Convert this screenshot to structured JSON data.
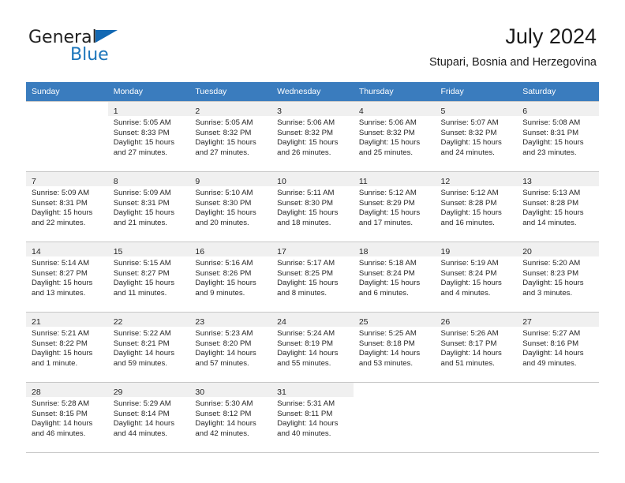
{
  "logo": {
    "word_top": "General",
    "word_bottom": "Blue",
    "triangle_icon": "triangle-icon",
    "accent_color": "#1b75bb"
  },
  "header": {
    "title": "July 2024",
    "subtitle": "Stupari, Bosnia and Herzegovina"
  },
  "calendar": {
    "header_background": "#3a7cbe",
    "weekdays": [
      "Sunday",
      "Monday",
      "Tuesday",
      "Wednesday",
      "Thursday",
      "Friday",
      "Saturday"
    ],
    "weeks": [
      [
        {
          "day": "",
          "lines": []
        },
        {
          "day": "1",
          "lines": [
            "Sunrise: 5:05 AM",
            "Sunset: 8:33 PM",
            "Daylight: 15 hours",
            "and 27 minutes."
          ]
        },
        {
          "day": "2",
          "lines": [
            "Sunrise: 5:05 AM",
            "Sunset: 8:32 PM",
            "Daylight: 15 hours",
            "and 27 minutes."
          ]
        },
        {
          "day": "3",
          "lines": [
            "Sunrise: 5:06 AM",
            "Sunset: 8:32 PM",
            "Daylight: 15 hours",
            "and 26 minutes."
          ]
        },
        {
          "day": "4",
          "lines": [
            "Sunrise: 5:06 AM",
            "Sunset: 8:32 PM",
            "Daylight: 15 hours",
            "and 25 minutes."
          ]
        },
        {
          "day": "5",
          "lines": [
            "Sunrise: 5:07 AM",
            "Sunset: 8:32 PM",
            "Daylight: 15 hours",
            "and 24 minutes."
          ]
        },
        {
          "day": "6",
          "lines": [
            "Sunrise: 5:08 AM",
            "Sunset: 8:31 PM",
            "Daylight: 15 hours",
            "and 23 minutes."
          ]
        }
      ],
      [
        {
          "day": "7",
          "lines": [
            "Sunrise: 5:09 AM",
            "Sunset: 8:31 PM",
            "Daylight: 15 hours",
            "and 22 minutes."
          ]
        },
        {
          "day": "8",
          "lines": [
            "Sunrise: 5:09 AM",
            "Sunset: 8:31 PM",
            "Daylight: 15 hours",
            "and 21 minutes."
          ]
        },
        {
          "day": "9",
          "lines": [
            "Sunrise: 5:10 AM",
            "Sunset: 8:30 PM",
            "Daylight: 15 hours",
            "and 20 minutes."
          ]
        },
        {
          "day": "10",
          "lines": [
            "Sunrise: 5:11 AM",
            "Sunset: 8:30 PM",
            "Daylight: 15 hours",
            "and 18 minutes."
          ]
        },
        {
          "day": "11",
          "lines": [
            "Sunrise: 5:12 AM",
            "Sunset: 8:29 PM",
            "Daylight: 15 hours",
            "and 17 minutes."
          ]
        },
        {
          "day": "12",
          "lines": [
            "Sunrise: 5:12 AM",
            "Sunset: 8:28 PM",
            "Daylight: 15 hours",
            "and 16 minutes."
          ]
        },
        {
          "day": "13",
          "lines": [
            "Sunrise: 5:13 AM",
            "Sunset: 8:28 PM",
            "Daylight: 15 hours",
            "and 14 minutes."
          ]
        }
      ],
      [
        {
          "day": "14",
          "lines": [
            "Sunrise: 5:14 AM",
            "Sunset: 8:27 PM",
            "Daylight: 15 hours",
            "and 13 minutes."
          ]
        },
        {
          "day": "15",
          "lines": [
            "Sunrise: 5:15 AM",
            "Sunset: 8:27 PM",
            "Daylight: 15 hours",
            "and 11 minutes."
          ]
        },
        {
          "day": "16",
          "lines": [
            "Sunrise: 5:16 AM",
            "Sunset: 8:26 PM",
            "Daylight: 15 hours",
            "and 9 minutes."
          ]
        },
        {
          "day": "17",
          "lines": [
            "Sunrise: 5:17 AM",
            "Sunset: 8:25 PM",
            "Daylight: 15 hours",
            "and 8 minutes."
          ]
        },
        {
          "day": "18",
          "lines": [
            "Sunrise: 5:18 AM",
            "Sunset: 8:24 PM",
            "Daylight: 15 hours",
            "and 6 minutes."
          ]
        },
        {
          "day": "19",
          "lines": [
            "Sunrise: 5:19 AM",
            "Sunset: 8:24 PM",
            "Daylight: 15 hours",
            "and 4 minutes."
          ]
        },
        {
          "day": "20",
          "lines": [
            "Sunrise: 5:20 AM",
            "Sunset: 8:23 PM",
            "Daylight: 15 hours",
            "and 3 minutes."
          ]
        }
      ],
      [
        {
          "day": "21",
          "lines": [
            "Sunrise: 5:21 AM",
            "Sunset: 8:22 PM",
            "Daylight: 15 hours",
            "and 1 minute."
          ]
        },
        {
          "day": "22",
          "lines": [
            "Sunrise: 5:22 AM",
            "Sunset: 8:21 PM",
            "Daylight: 14 hours",
            "and 59 minutes."
          ]
        },
        {
          "day": "23",
          "lines": [
            "Sunrise: 5:23 AM",
            "Sunset: 8:20 PM",
            "Daylight: 14 hours",
            "and 57 minutes."
          ]
        },
        {
          "day": "24",
          "lines": [
            "Sunrise: 5:24 AM",
            "Sunset: 8:19 PM",
            "Daylight: 14 hours",
            "and 55 minutes."
          ]
        },
        {
          "day": "25",
          "lines": [
            "Sunrise: 5:25 AM",
            "Sunset: 8:18 PM",
            "Daylight: 14 hours",
            "and 53 minutes."
          ]
        },
        {
          "day": "26",
          "lines": [
            "Sunrise: 5:26 AM",
            "Sunset: 8:17 PM",
            "Daylight: 14 hours",
            "and 51 minutes."
          ]
        },
        {
          "day": "27",
          "lines": [
            "Sunrise: 5:27 AM",
            "Sunset: 8:16 PM",
            "Daylight: 14 hours",
            "and 49 minutes."
          ]
        }
      ],
      [
        {
          "day": "28",
          "lines": [
            "Sunrise: 5:28 AM",
            "Sunset: 8:15 PM",
            "Daylight: 14 hours",
            "and 46 minutes."
          ]
        },
        {
          "day": "29",
          "lines": [
            "Sunrise: 5:29 AM",
            "Sunset: 8:14 PM",
            "Daylight: 14 hours",
            "and 44 minutes."
          ]
        },
        {
          "day": "30",
          "lines": [
            "Sunrise: 5:30 AM",
            "Sunset: 8:12 PM",
            "Daylight: 14 hours",
            "and 42 minutes."
          ]
        },
        {
          "day": "31",
          "lines": [
            "Sunrise: 5:31 AM",
            "Sunset: 8:11 PM",
            "Daylight: 14 hours",
            "and 40 minutes."
          ]
        },
        {
          "day": "",
          "lines": []
        },
        {
          "day": "",
          "lines": []
        },
        {
          "day": "",
          "lines": []
        }
      ]
    ]
  }
}
